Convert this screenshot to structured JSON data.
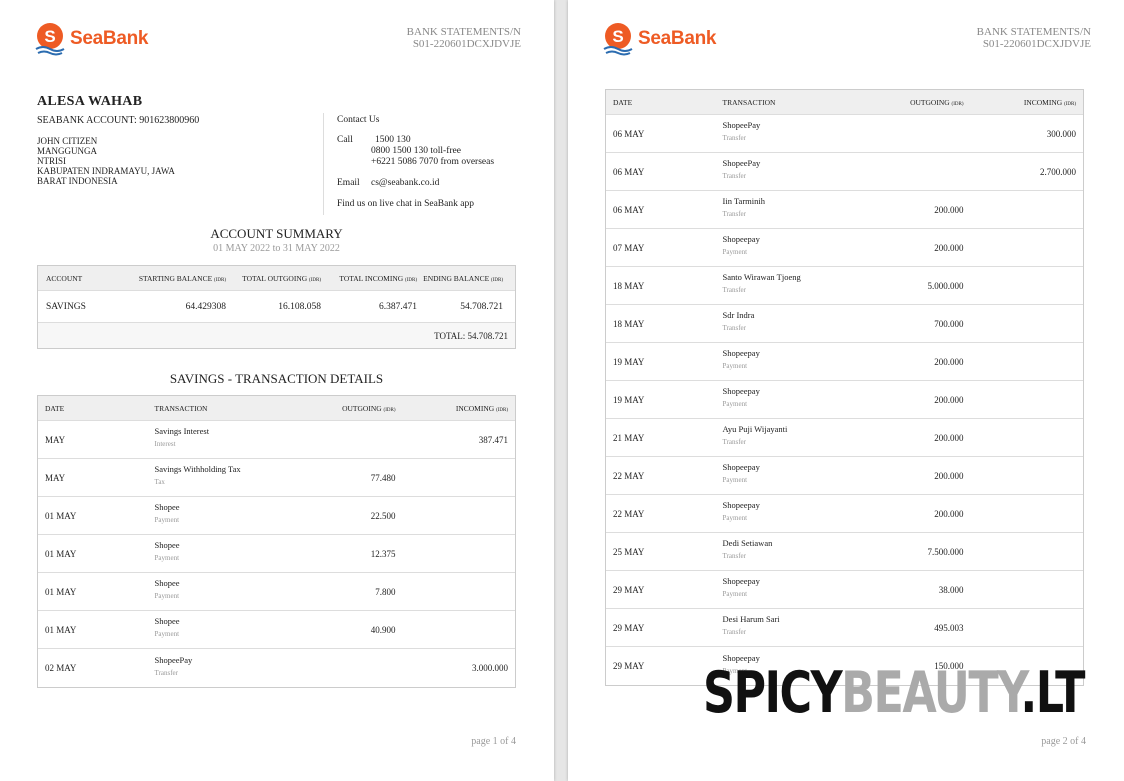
{
  "brand": {
    "name": "SeaBank",
    "color": "#ee5b24"
  },
  "statement_id": "BANK STATEMENTS/N S01-220601DCXJDVJE",
  "customer": {
    "name": "ALESA WAHAB",
    "account": "SEABANK ACCOUNT: 901623800960",
    "address": [
      "JOHN CITIZEN",
      "MANGGUNGA",
      "NTRISI",
      "KABUPATEN INDRAMAYU, JAWA",
      "BARAT INDONESIA"
    ]
  },
  "contact": {
    "title": "Contact Us",
    "call_label": "Call",
    "call_lines": [
      "1500 130",
      "0800 1500 130 toll-free",
      "+6221 5086 7070 from overseas"
    ],
    "email_label": "Email",
    "email": "cs@seabank.co.id",
    "live_chat": "Find us on live chat in SeaBank app"
  },
  "summary": {
    "title": "ACCOUNT SUMMARY",
    "period": "01 MAY 2022 to 31 MAY 2022",
    "headers": {
      "account": "ACCOUNT",
      "starting": "STARTING BALANCE",
      "outgoing": "TOTAL OUTGOING",
      "incoming": "TOTAL INCOMING",
      "ending": "ENDING BALANCE",
      "unit": "(IDR)"
    },
    "row": {
      "account": "SAVINGS",
      "starting": "64.429308",
      "outgoing": "16.108.058",
      "incoming": "6.387.471",
      "ending": "54.708.721"
    },
    "total": "TOTAL: 54.708.721"
  },
  "details_title": "SAVINGS - TRANSACTION DETAILS",
  "tx_headers": {
    "date": "DATE",
    "transaction": "TRANSACTION",
    "outgoing": "OUTGOING",
    "incoming": "INCOMING",
    "unit": "(IDR)"
  },
  "page1_transactions": [
    {
      "date": "MAY",
      "desc": "Savings Interest",
      "type": "Interest",
      "out": "",
      "in": "387.471"
    },
    {
      "date": "MAY",
      "desc": "Savings Withholding Tax",
      "type": "Tax",
      "out": "77.480",
      "in": ""
    },
    {
      "date": "01 MAY",
      "desc": "Shopee",
      "type": "Payment",
      "out": "22.500",
      "in": ""
    },
    {
      "date": "01 MAY",
      "desc": "Shopee",
      "type": "Payment",
      "out": "12.375",
      "in": ""
    },
    {
      "date": "01 MAY",
      "desc": "Shopee",
      "type": "Payment",
      "out": "7.800",
      "in": ""
    },
    {
      "date": "01 MAY",
      "desc": "Shopee",
      "type": "Payment",
      "out": "40.900",
      "in": ""
    },
    {
      "date": "02 MAY",
      "desc": "ShopeePay",
      "type": "Transfer",
      "out": "",
      "in": "3.000.000"
    }
  ],
  "page2_transactions": [
    {
      "date": "06 MAY",
      "desc": "ShopeePay",
      "type": "Transfer",
      "out": "",
      "in": "300.000"
    },
    {
      "date": "06 MAY",
      "desc": "ShopeePay",
      "type": "Transfer",
      "out": "",
      "in": "2.700.000"
    },
    {
      "date": "06 MAY",
      "desc": "Iin Tarminih",
      "type": "Transfer",
      "out": "200.000",
      "in": ""
    },
    {
      "date": "07 MAY",
      "desc": "Shopeepay",
      "type": "Payment",
      "out": "200.000",
      "in": ""
    },
    {
      "date": "18 MAY",
      "desc": "Santo Wirawan Tjoeng",
      "type": "Transfer",
      "out": "5.000.000",
      "in": ""
    },
    {
      "date": "18 MAY",
      "desc": "Sdr Indra",
      "type": "Transfer",
      "out": "700.000",
      "in": ""
    },
    {
      "date": "19 MAY",
      "desc": "Shopeepay",
      "type": "Payment",
      "out": "200.000",
      "in": ""
    },
    {
      "date": "19 MAY",
      "desc": "Shopeepay",
      "type": "Payment",
      "out": "200.000",
      "in": ""
    },
    {
      "date": "21 MAY",
      "desc": "Ayu Puji Wijayanti",
      "type": "Transfer",
      "out": "200.000",
      "in": ""
    },
    {
      "date": "22 MAY",
      "desc": "Shopeepay",
      "type": "Payment",
      "out": "200.000",
      "in": ""
    },
    {
      "date": "22 MAY",
      "desc": "Shopeepay",
      "type": "Payment",
      "out": "200.000",
      "in": ""
    },
    {
      "date": "25 MAY",
      "desc": "Dedi Setiawan",
      "type": "Transfer",
      "out": "7.500.000",
      "in": ""
    },
    {
      "date": "29 MAY",
      "desc": "Shopeepay",
      "type": "Payment",
      "out": "38.000",
      "in": ""
    },
    {
      "date": "29 MAY",
      "desc": "Desi Harum Sari",
      "type": "Transfer",
      "out": "495.003",
      "in": ""
    },
    {
      "date": "29 MAY",
      "desc": "Shopeepay",
      "type": "Payment",
      "out": "150.000",
      "in": ""
    }
  ],
  "page1_label": "page 1 of 4",
  "page2_label": "page 2 of 4",
  "watermark": {
    "part1": "SPICY",
    "part2": "BEAUTY",
    "part3": ".LT"
  }
}
